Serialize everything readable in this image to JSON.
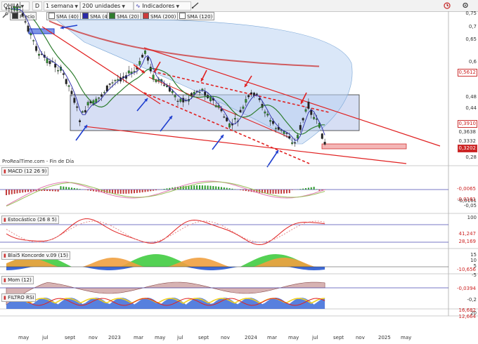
{
  "toolbar": {
    "ticker": "OHLA",
    "d_button": "D",
    "period": "1 semana",
    "units": "200 unidades",
    "indicators": "Indicadores"
  },
  "legend": [
    {
      "label": "Precio",
      "color": "#333333"
    },
    {
      "label": "SMA (40)",
      "color": "#ffffff"
    },
    {
      "label": "SMA (4)",
      "color": "#2a2aa8"
    },
    {
      "label": "SMA (20)",
      "color": "#2e7d2e"
    },
    {
      "label": "SMA (200)",
      "color": "#cc3b3b"
    },
    {
      "label": "SMA (120)",
      "color": "#ffffff"
    }
  ],
  "source_text": "ProRealTime.com - Fin de Día",
  "price_axis": [
    "0,75",
    "0,7",
    "0,65",
    "0,6",
    "0,48",
    "0,44",
    "0,28"
  ],
  "price_tags": [
    {
      "label": "0,5612",
      "style": "outline"
    },
    {
      "label": "0,3910",
      "style": "outline"
    },
    {
      "label": "0,3638",
      "style": "plain"
    },
    {
      "label": "0,3332",
      "style": "plain"
    },
    {
      "label": "0,3202",
      "style": "fill"
    }
  ],
  "panels": [
    {
      "name": "MACD (12 26 9)",
      "ticks": [
        "-0,0161",
        "-0,05"
      ],
      "tags": [
        "-0,0065",
        "-0,0161"
      ]
    },
    {
      "name": "Estocástico (26 8 5)",
      "ticks": [
        "100"
      ],
      "tags": [
        "41,247",
        "28,169"
      ]
    },
    {
      "name": "Blai5 Koncorde v.09 (15)",
      "ticks": [
        "15",
        "10",
        "5",
        "-5"
      ],
      "tags": [
        "-10,656"
      ]
    },
    {
      "name": "Mom (12)",
      "ticks": [
        "-0,2"
      ],
      "tags": [
        "-0,0394"
      ]
    },
    {
      "name": "FILTRO RSI",
      "ticks": [
        "20"
      ],
      "tags": [
        "16,682",
        "12,664"
      ]
    }
  ],
  "time_axis": [
    "may",
    "jul",
    "sept",
    "nov",
    "2023",
    "mar",
    "may",
    "jul",
    "sept",
    "nov",
    "2024",
    "mar",
    "may",
    "jul",
    "sept",
    "nov",
    "2025",
    "may"
  ],
  "colors": {
    "candles_up": "#2e8b2e",
    "candles_down": "#222222",
    "trendlines": "#e02020",
    "arrows_blue": "#1f3fcf",
    "box_fill": "#8aa0e0"
  }
}
